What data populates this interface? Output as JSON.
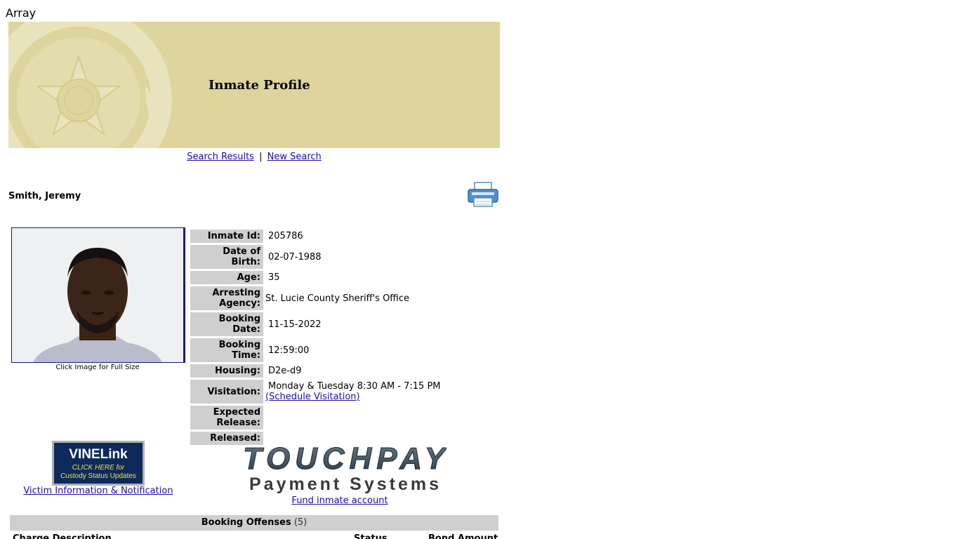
{
  "debug_text": "Array",
  "banner": {
    "title": "Inmate Profile"
  },
  "nav": {
    "search_results": "Search Results",
    "separator": "|",
    "new_search": "New Search"
  },
  "inmate_name": "Smith, Jeremy",
  "photo_caption": "Click Image for Full Size",
  "info": {
    "inmate_id_label": "Inmate Id:",
    "inmate_id": "205786",
    "dob_label": "Date of Birth:",
    "dob": "02-07-1988",
    "age_label": "Age:",
    "age": "35",
    "agency_label_1": "Arresting",
    "agency_label_2": "Agency:",
    "agency": "St. Lucie County Sheriff's Office",
    "booking_date_label": "Booking Date:",
    "booking_date": "11-15-2022",
    "booking_time_label": "Booking Time:",
    "booking_time": "12:59:00",
    "housing_label": "Housing:",
    "housing": "D2e-d9",
    "visitation_label": "Visitation:",
    "visitation": "Monday & Tuesday 8:30 AM - 7:15 PM",
    "schedule_link": "(Schedule Visitation)",
    "expected_label_1": "Expected",
    "expected_label_2": "Release:",
    "expected": "",
    "released_label": "Released:",
    "released": ""
  },
  "vine": {
    "brand": "VINELink",
    "line1": "CLICK HERE for",
    "line2": "Custody Status Updates",
    "caption": "Victim Information & Notification"
  },
  "touchpay": {
    "brand": "TOUCHPAY",
    "subtitle": "Payment Systems",
    "link": "Fund inmate account"
  },
  "offenses": {
    "title": "Booking Offenses",
    "count": "(5)",
    "col_charge": "Charge Description",
    "col_status": "Status",
    "col_bond": "Bond Amount"
  },
  "colors": {
    "banner": "#ddd59d",
    "label_bg": "#cfcfcf",
    "link": "#1a0dab"
  }
}
